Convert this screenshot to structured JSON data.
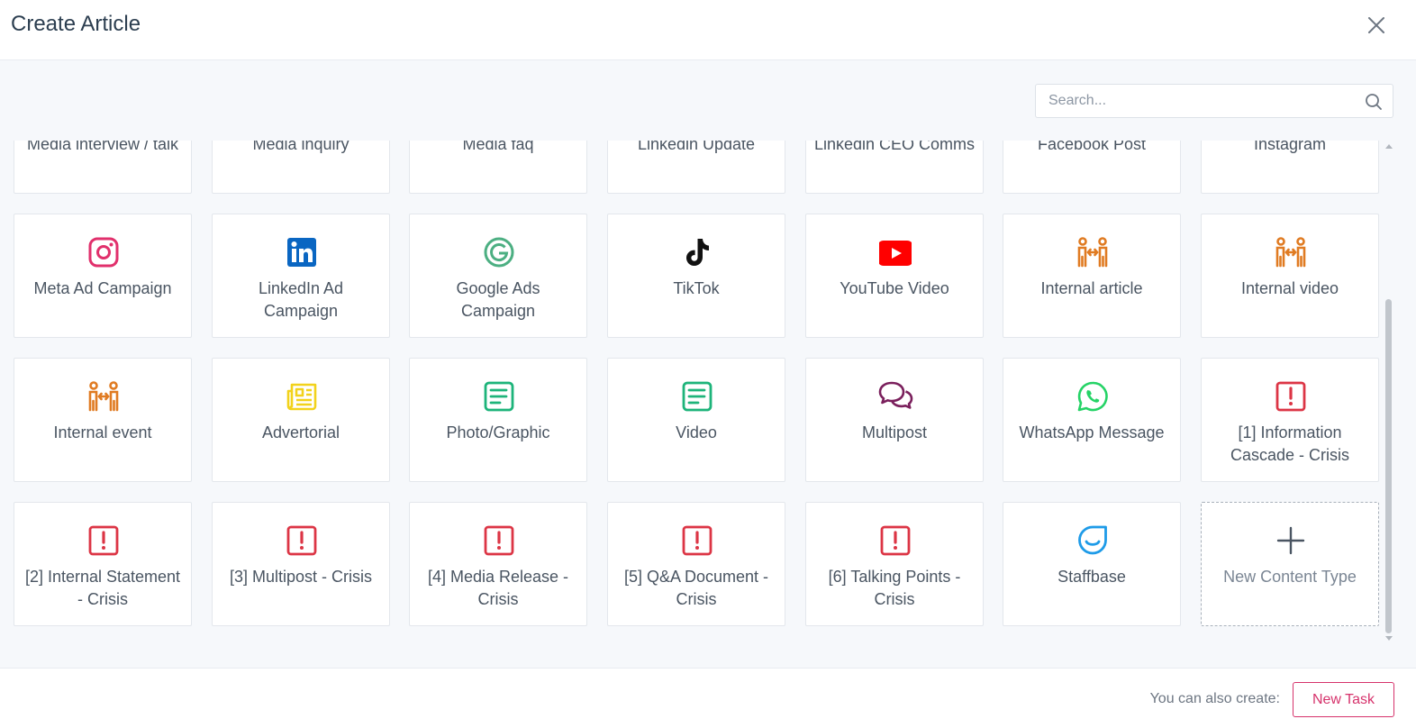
{
  "header": {
    "title": "Create Article",
    "close_icon": "close-icon"
  },
  "search": {
    "placeholder": "Search...",
    "icon": "search-icon"
  },
  "tiles": [
    {
      "label": "Media interview / talk",
      "icon": "none"
    },
    {
      "label": "Media inquiry",
      "icon": "none"
    },
    {
      "label": "Media faq",
      "icon": "none"
    },
    {
      "label": "Linkedin Update",
      "icon": "none"
    },
    {
      "label": "Linkedin CEO Comms",
      "icon": "none"
    },
    {
      "label": "Facebook Post",
      "icon": "none"
    },
    {
      "label": "Instagram",
      "icon": "none"
    },
    {
      "label": "Meta Ad Campaign",
      "icon": "instagram-icon"
    },
    {
      "label": "LinkedIn Ad Campaign",
      "icon": "linkedin-icon"
    },
    {
      "label": "Google Ads Campaign",
      "icon": "google-icon"
    },
    {
      "label": "TikTok",
      "icon": "tiktok-icon"
    },
    {
      "label": "YouTube Video",
      "icon": "youtube-icon"
    },
    {
      "label": "Internal article",
      "icon": "people-exchange-icon"
    },
    {
      "label": "Internal video",
      "icon": "people-exchange-icon"
    },
    {
      "label": "Internal event",
      "icon": "people-exchange-icon"
    },
    {
      "label": "Advertorial",
      "icon": "newspaper-icon"
    },
    {
      "label": "Photo/Graphic",
      "icon": "document-icon"
    },
    {
      "label": "Video",
      "icon": "document-icon"
    },
    {
      "label": "Multipost",
      "icon": "chat-bubbles-icon"
    },
    {
      "label": "WhatsApp Message",
      "icon": "whatsapp-icon"
    },
    {
      "label": "[1] Information Cascade - Crisis",
      "icon": "alert-icon"
    },
    {
      "label": "[2] Internal Statement - Crisis",
      "icon": "alert-icon"
    },
    {
      "label": "[3] Multipost - Crisis",
      "icon": "alert-icon"
    },
    {
      "label": "[4] Media Release - Crisis",
      "icon": "alert-icon"
    },
    {
      "label": "[5] Q&A Document - Crisis",
      "icon": "alert-icon"
    },
    {
      "label": "[6] Talking Points - Crisis",
      "icon": "alert-icon"
    },
    {
      "label": "Staffbase",
      "icon": "staffbase-icon"
    },
    {
      "label": "New Content Type",
      "icon": "plus-icon"
    }
  ],
  "footer": {
    "also_label": "You can also create:",
    "new_task_label": "New Task"
  },
  "colors": {
    "accent": "#d6336c",
    "orange": "#e07b22",
    "green": "#1db47a",
    "red": "#dc3545",
    "linkedin": "#0a66c2",
    "youtube": "#ff0000",
    "whatsapp": "#25d366",
    "staffbase": "#1e9be8",
    "purple": "#7a1f5c",
    "yellow": "#f2d21b"
  }
}
